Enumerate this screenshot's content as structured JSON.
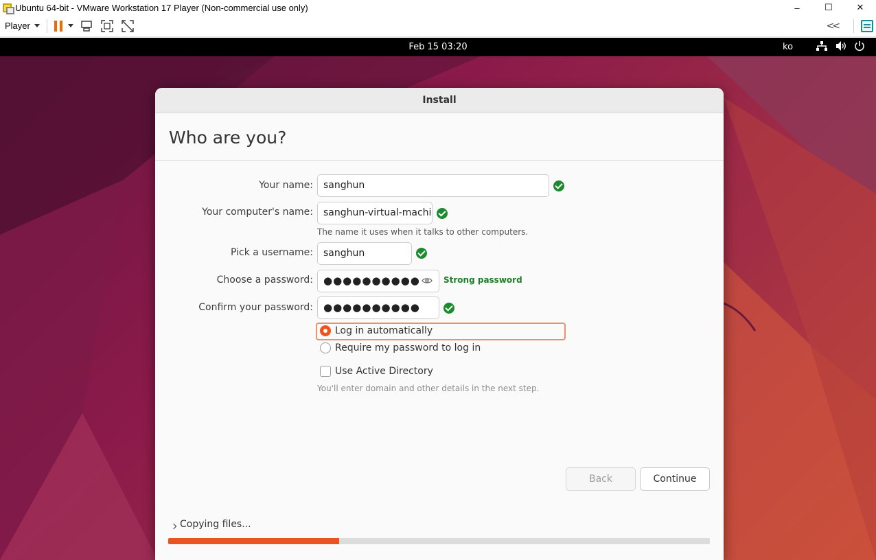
{
  "window": {
    "title": "Ubuntu 64-bit - VMware Workstation 17 Player (Non-commercial use only)",
    "minimize": "–",
    "maximize": "☐",
    "close": "✕"
  },
  "toolbar": {
    "player_label": "Player"
  },
  "topbar": {
    "datetime": "Feb 15  03:20",
    "language": "ko"
  },
  "installer": {
    "header_title": "Install",
    "page_title": "Who are you?",
    "fields": {
      "your_name": {
        "label": "Your name:",
        "value": "sanghun"
      },
      "computer_name": {
        "label": "Your computer's name:",
        "value": "sanghun-virtual-machine",
        "hint": "The name it uses when it talks to other computers."
      },
      "username": {
        "label": "Pick a username:",
        "value": "sanghun"
      },
      "password": {
        "label": "Choose a password:",
        "value": "●●●●●●●●●●",
        "strength": "Strong password"
      },
      "confirm_password": {
        "label": "Confirm your password:",
        "value": "●●●●●●●●●●"
      }
    },
    "login_options": {
      "auto": "Log in automatically",
      "require": "Require my password to log in",
      "selected": "auto"
    },
    "active_directory": {
      "label": "Use Active Directory",
      "checked": false,
      "hint": "You'll enter domain and other details in the next step."
    },
    "buttons": {
      "back": "Back",
      "continue": "Continue"
    },
    "progress": {
      "label": "Copying files...",
      "fraction": 0.315
    }
  },
  "colors": {
    "accent": "#e95420",
    "success": "#1c8a2f",
    "vmware_pause": "#f06a00"
  }
}
